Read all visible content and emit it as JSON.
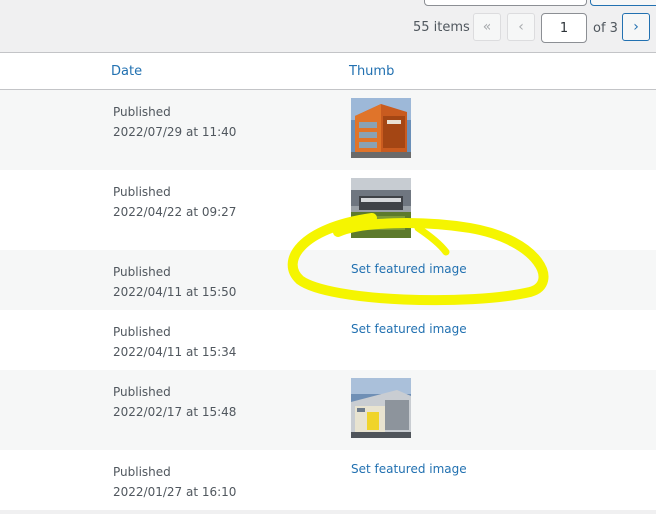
{
  "pagination": {
    "items_count": "55 items",
    "first_label": "«",
    "prev_label": "‹",
    "current_page": "1",
    "of_pages": "of 3",
    "next_label": "›"
  },
  "table": {
    "columns": {
      "date": "Date",
      "thumb": "Thumb"
    },
    "rows": [
      {
        "status": "Published",
        "date": "2022/07/29 at 11:40",
        "thumb": "image"
      },
      {
        "status": "Published",
        "date": "2022/04/22 at 09:27",
        "thumb": "image"
      },
      {
        "status": "Published",
        "date": "2022/04/11 at 15:50",
        "thumb": "link",
        "link_label": "Set featured image"
      },
      {
        "status": "Published",
        "date": "2022/04/11 at 15:34",
        "thumb": "link",
        "link_label": "Set featured image"
      },
      {
        "status": "Published",
        "date": "2022/02/17 at 15:48",
        "thumb": "image"
      },
      {
        "status": "Published",
        "date": "2022/01/27 at 16:10",
        "thumb": "link",
        "link_label": "Set featured image"
      }
    ]
  },
  "colors": {
    "accent": "#2271b1",
    "highlight": "#f5f500"
  }
}
